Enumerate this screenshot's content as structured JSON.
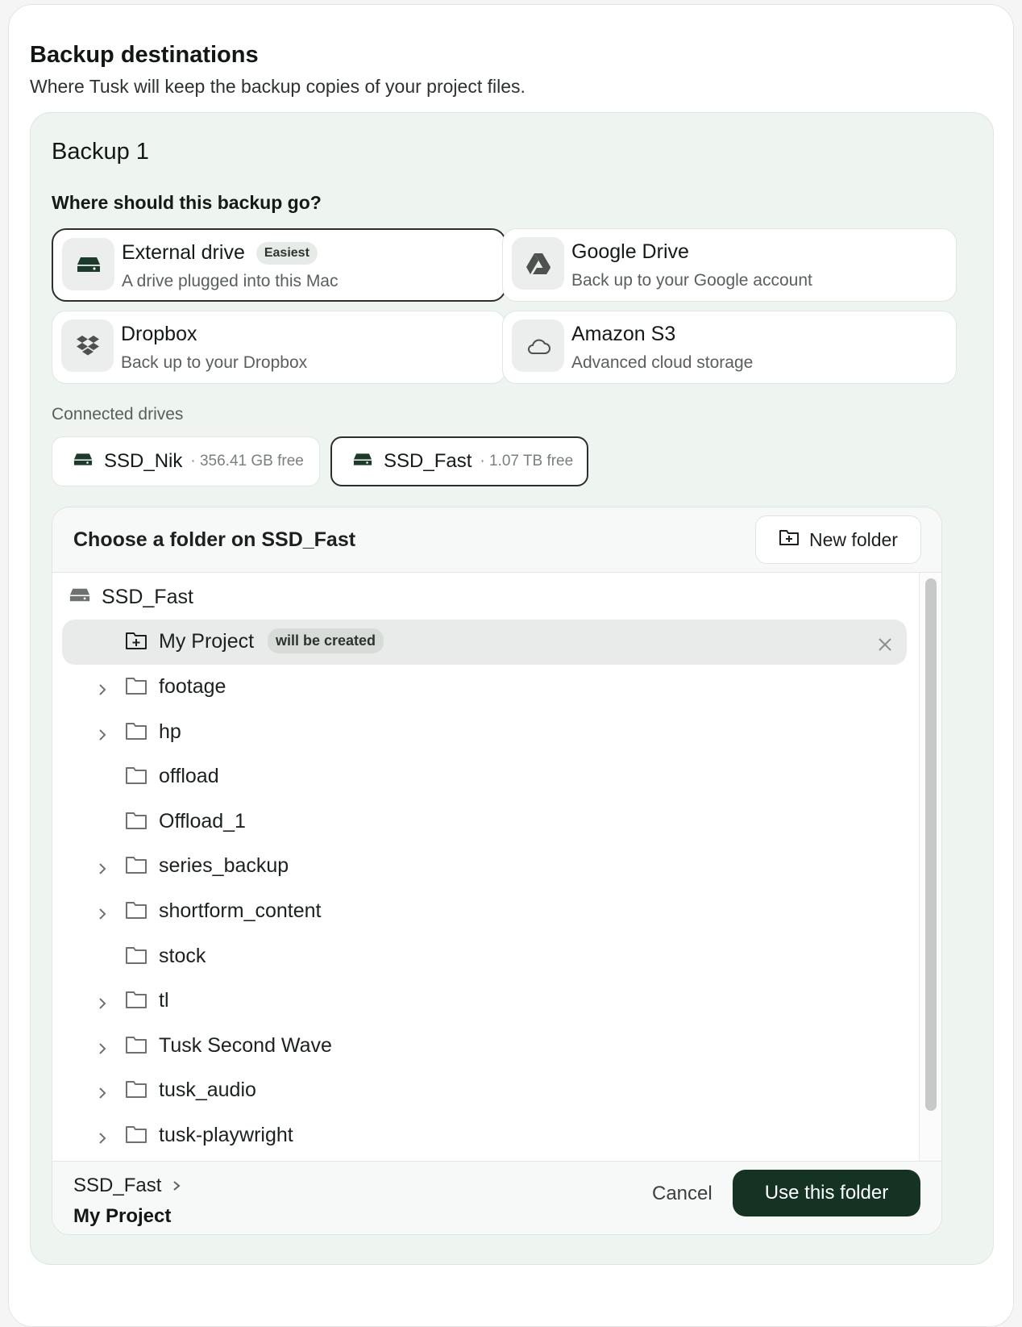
{
  "page": {
    "title": "Backup destinations",
    "subtitle": "Where Tusk will keep the backup copies of your project files."
  },
  "backup": {
    "title": "Backup 1",
    "question": "Where should this backup go?",
    "destinations": [
      {
        "title": "External drive",
        "badge": "Easiest",
        "desc": "A drive plugged into this Mac",
        "icon": "drive-icon",
        "selected": true
      },
      {
        "title": "Google Drive",
        "desc": "Back up to your Google account",
        "icon": "google-drive-icon"
      },
      {
        "title": "Dropbox",
        "desc": "Back up to your Dropbox",
        "icon": "dropbox-icon"
      },
      {
        "title": "Amazon S3",
        "desc": "Advanced cloud storage",
        "icon": "cloud-icon"
      }
    ],
    "connected_label": "Connected drives",
    "drives": [
      {
        "name": "SSD_Nik",
        "free": "· 356.41 GB free"
      },
      {
        "name": "SSD_Fast",
        "free": "· 1.07 TB free",
        "selected": true
      }
    ]
  },
  "picker": {
    "title": "Choose a folder on SSD_Fast",
    "new_folder_label": "New folder",
    "root": "SSD_Fast",
    "pending": {
      "name": "My Project",
      "badge": "will be created"
    },
    "folders": [
      {
        "name": "footage",
        "expandable": true
      },
      {
        "name": "hp",
        "expandable": true
      },
      {
        "name": "offload",
        "expandable": false
      },
      {
        "name": "Offload_1",
        "expandable": false
      },
      {
        "name": "series_backup",
        "expandable": true
      },
      {
        "name": "shortform_content",
        "expandable": true
      },
      {
        "name": "stock",
        "expandable": false
      },
      {
        "name": "tl",
        "expandable": true
      },
      {
        "name": "Tusk Second Wave",
        "expandable": true
      },
      {
        "name": "tusk_audio",
        "expandable": true
      },
      {
        "name": "tusk-playwright",
        "expandable": true
      }
    ],
    "breadcrumb": [
      "SSD_Fast",
      "My Project"
    ],
    "cancel_label": "Cancel",
    "use_label": "Use this folder"
  },
  "colors": {
    "accent": "#143322",
    "card_bg": "#eef4ef"
  }
}
